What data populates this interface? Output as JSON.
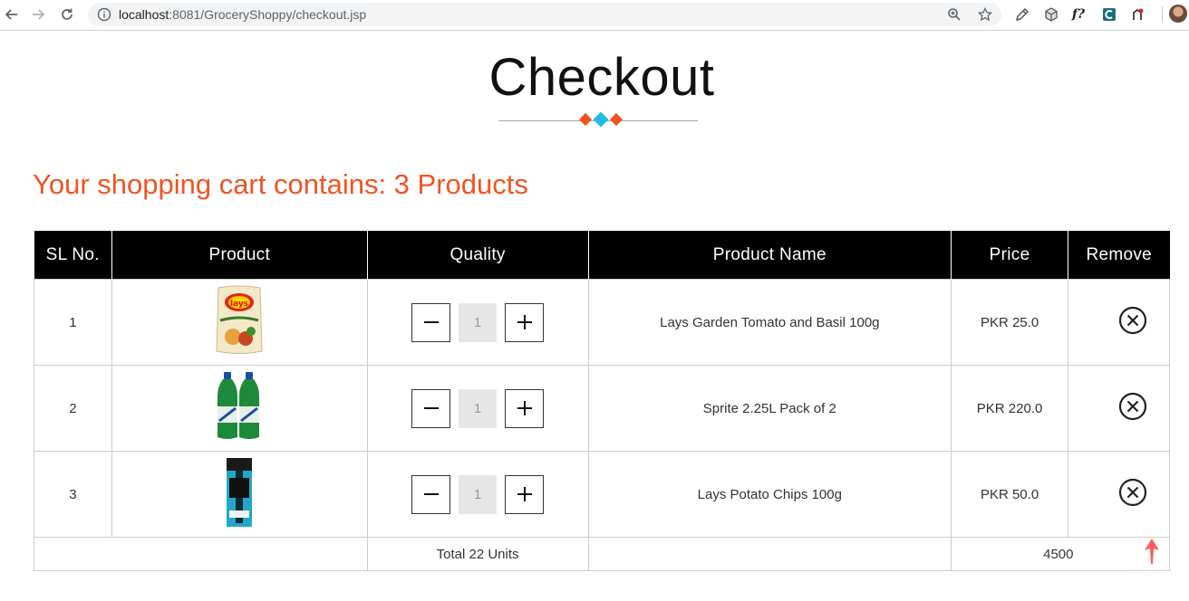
{
  "browser": {
    "url_host": "localhost",
    "url_path": ":8081/GroceryShoppy/checkout.jsp",
    "icons": [
      "back-icon",
      "forward-icon",
      "reload-icon",
      "info-icon",
      "zoom-icon",
      "bookmark-star-icon",
      "eyedropper-icon",
      "cube-extension-icon",
      "fonts-extension-icon",
      "extension-icon",
      "extension-icon",
      "profile-avatar"
    ],
    "font_ext_label": "f?"
  },
  "page": {
    "title": "Checkout",
    "cart_summary": "Your shopping cart contains: 3 Products",
    "accent_color": "#f05423",
    "diamond_colors": [
      "#f05423",
      "#22b8e8",
      "#f05423"
    ]
  },
  "table": {
    "headers": [
      "SL No.",
      "Product",
      "Quality",
      "Product Name",
      "Price",
      "Remove"
    ],
    "rows": [
      {
        "sl": "1",
        "product_image": "lays-chips-bag",
        "quantity": "1",
        "name": "Lays Garden Tomato and Basil 100g",
        "price": "PKR 25.0"
      },
      {
        "sl": "2",
        "product_image": "sprite-bottles",
        "quantity": "1",
        "name": "Sprite 2.25L Pack of 2",
        "price": "PKR 220.0"
      },
      {
        "sl": "3",
        "product_image": "lakme-eyeconic-kajal",
        "quantity": "1",
        "name": "Lays Potato Chips 100g",
        "price": "PKR 50.0"
      }
    ],
    "total_units": "Total 22 Units",
    "total_price": "4500"
  }
}
